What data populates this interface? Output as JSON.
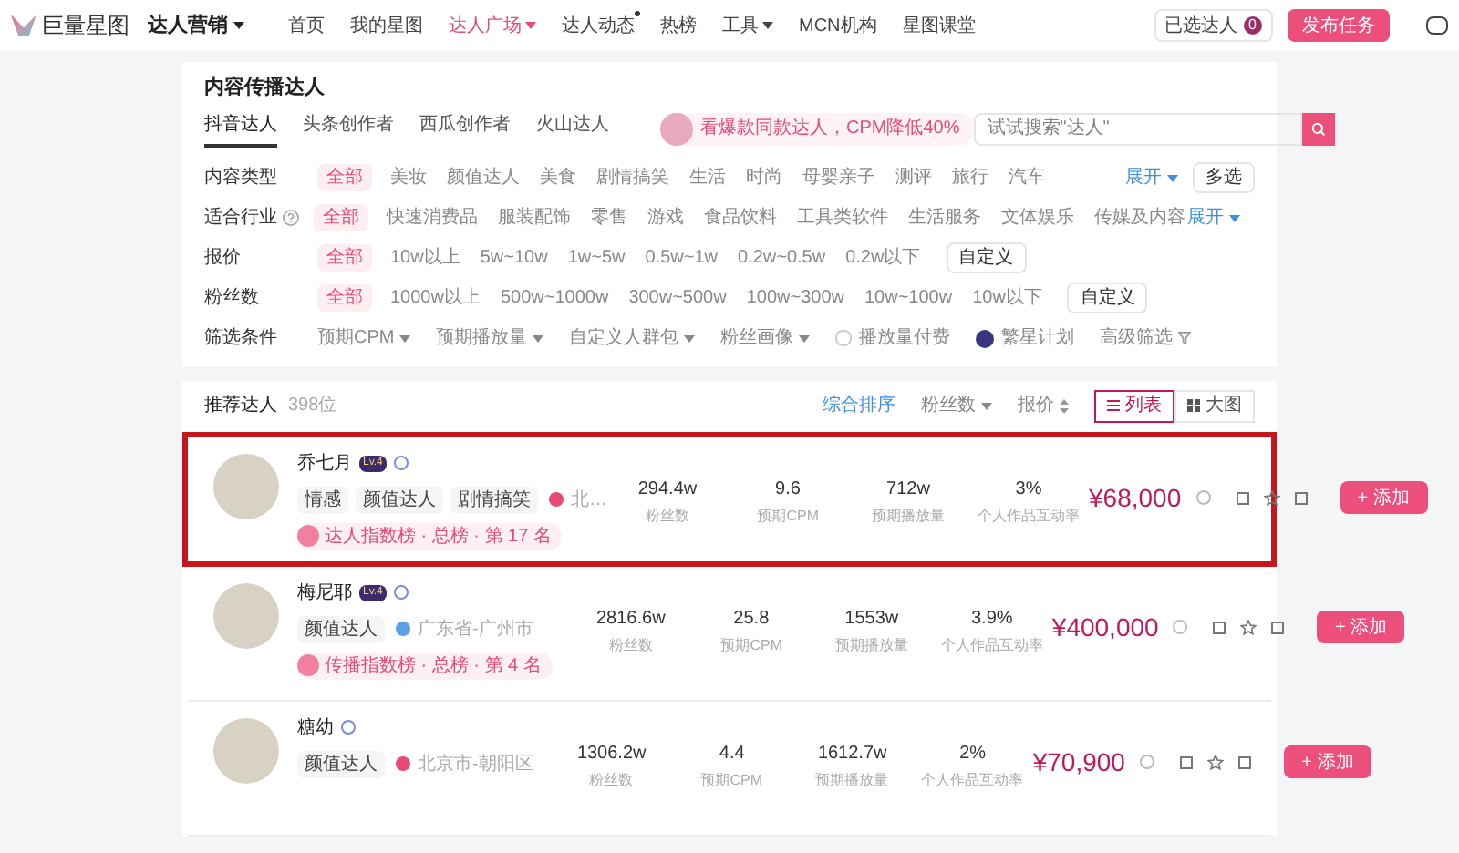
{
  "brand": {
    "logo": "巨量星图",
    "product": "达人营销"
  },
  "nav": [
    {
      "label": "首页",
      "selected": false,
      "caret": false,
      "dot": false
    },
    {
      "label": "我的星图",
      "selected": false,
      "caret": false,
      "dot": false
    },
    {
      "label": "达人广场",
      "selected": true,
      "caret": true,
      "dot": false
    },
    {
      "label": "达人动态",
      "selected": false,
      "caret": false,
      "dot": true
    },
    {
      "label": "热榜",
      "selected": false,
      "caret": false,
      "dot": false
    },
    {
      "label": "工具",
      "selected": false,
      "caret": true,
      "dot": false
    },
    {
      "label": "MCN机构",
      "selected": false,
      "caret": false,
      "dot": false
    },
    {
      "label": "星图课堂",
      "selected": false,
      "caret": false,
      "dot": false
    }
  ],
  "selected_creators": {
    "label": "已选达人",
    "count": "0"
  },
  "publish_button": "发布任务",
  "filter_panel": {
    "title": "内容传播达人",
    "tabs": [
      {
        "label": "抖音达人",
        "selected": true
      },
      {
        "label": "头条创作者",
        "selected": false
      },
      {
        "label": "西瓜创作者",
        "selected": false
      },
      {
        "label": "火山达人",
        "selected": false
      }
    ],
    "promo": "看爆款同款达人，CPM降低40%",
    "search": {
      "placeholder": "试试搜索\"达人\""
    },
    "rows": [
      {
        "label": "内容类型",
        "options": [
          {
            "label": "全部",
            "selected": true
          },
          {
            "label": "美妆",
            "selected": false
          },
          {
            "label": "颜值达人",
            "selected": false
          },
          {
            "label": "美食",
            "selected": false
          },
          {
            "label": "剧情搞笑",
            "selected": false
          },
          {
            "label": "生活",
            "selected": false
          },
          {
            "label": "时尚",
            "selected": false
          },
          {
            "label": "母婴亲子",
            "selected": false
          },
          {
            "label": "测评",
            "selected": false
          },
          {
            "label": "旅行",
            "selected": false
          },
          {
            "label": "汽车",
            "selected": false
          }
        ],
        "expand": "展开",
        "button": "多选"
      },
      {
        "label": "适合行业",
        "help": true,
        "options": [
          {
            "label": "全部",
            "selected": true
          },
          {
            "label": "快速消费品",
            "selected": false
          },
          {
            "label": "服装配饰",
            "selected": false
          },
          {
            "label": "零售",
            "selected": false
          },
          {
            "label": "游戏",
            "selected": false
          },
          {
            "label": "食品饮料",
            "selected": false
          },
          {
            "label": "工具类软件",
            "selected": false
          },
          {
            "label": "生活服务",
            "selected": false
          },
          {
            "label": "文体娱乐",
            "selected": false
          },
          {
            "label": "传媒及内容",
            "selected": false
          }
        ],
        "expand": "展开"
      },
      {
        "label": "报价",
        "options": [
          {
            "label": "全部",
            "selected": true
          },
          {
            "label": "10w以上",
            "selected": false
          },
          {
            "label": "5w~10w",
            "selected": false
          },
          {
            "label": "1w~5w",
            "selected": false
          },
          {
            "label": "0.5w~1w",
            "selected": false
          },
          {
            "label": "0.2w~0.5w",
            "selected": false
          },
          {
            "label": "0.2w以下",
            "selected": false
          }
        ],
        "button": "自定义"
      },
      {
        "label": "粉丝数",
        "options": [
          {
            "label": "全部",
            "selected": true
          },
          {
            "label": "1000w以上",
            "selected": false
          },
          {
            "label": "500w~1000w",
            "selected": false
          },
          {
            "label": "300w~500w",
            "selected": false
          },
          {
            "label": "100w~300w",
            "selected": false
          },
          {
            "label": "10w~100w",
            "selected": false
          },
          {
            "label": "10w以下",
            "selected": false
          }
        ],
        "button": "自定义"
      }
    ],
    "conditions": {
      "label": "筛选条件",
      "dropdowns": [
        "预期CPM",
        "预期播放量",
        "自定义人群包",
        "粉丝画像"
      ],
      "play_paid": {
        "label": "播放量付费",
        "checked": false
      },
      "star_plan": {
        "label": "繁星计划",
        "on": true
      },
      "advanced": "高级筛选"
    }
  },
  "results": {
    "title": "推荐达人",
    "count": "398位",
    "sorts": [
      {
        "label": "综合排序",
        "selected": true,
        "kind": "plain"
      },
      {
        "label": "粉丝数",
        "selected": false,
        "kind": "caret"
      },
      {
        "label": "报价",
        "selected": false,
        "kind": "updown"
      }
    ],
    "views": [
      {
        "label": "列表",
        "selected": true,
        "kind": "list"
      },
      {
        "label": "大图",
        "selected": false,
        "kind": "grid"
      }
    ],
    "creators": [
      {
        "name": "乔七月",
        "level": "Lv.4",
        "highlighted": true,
        "tags": [
          "情感",
          "颜值达人",
          "剧情搞笑"
        ],
        "location": {
          "text": "北…",
          "color": "#e84a73"
        },
        "stats": [
          {
            "value": "294.4w",
            "label": "粉丝数"
          },
          {
            "value": "9.6",
            "label": "预期CPM"
          },
          {
            "value": "712w",
            "label": "预期播放量"
          },
          {
            "value": "3%",
            "label": "个人作品互动率"
          }
        ],
        "rank": "达人指数榜 · 总榜 · 第 17 名",
        "price": "¥68,000",
        "add": "+ 添加"
      },
      {
        "name": "梅尼耶",
        "level": "Lv.4",
        "highlighted": false,
        "tags": [
          "颜值达人"
        ],
        "location": {
          "text": "广东省-广州市",
          "color": "#5aa0e6"
        },
        "stats": [
          {
            "value": "2816.6w",
            "label": "粉丝数"
          },
          {
            "value": "25.8",
            "label": "预期CPM"
          },
          {
            "value": "1553w",
            "label": "预期播放量"
          },
          {
            "value": "3.9%",
            "label": "个人作品互动率"
          }
        ],
        "rank": "传播指数榜 · 总榜 · 第 4 名",
        "price": "¥400,000",
        "add": "+ 添加"
      },
      {
        "name": "糖幼",
        "highlighted": false,
        "tags": [
          "颜值达人"
        ],
        "location": {
          "text": "北京市-朝阳区",
          "color": "#e84a73"
        },
        "stats": [
          {
            "value": "1306.2w",
            "label": "粉丝数"
          },
          {
            "value": "4.4",
            "label": "预期CPM"
          },
          {
            "value": "1612.7w",
            "label": "预期播放量"
          },
          {
            "value": "2%",
            "label": "个人作品互动率"
          }
        ],
        "price": "¥70,900",
        "add": "+ 添加"
      }
    ]
  }
}
